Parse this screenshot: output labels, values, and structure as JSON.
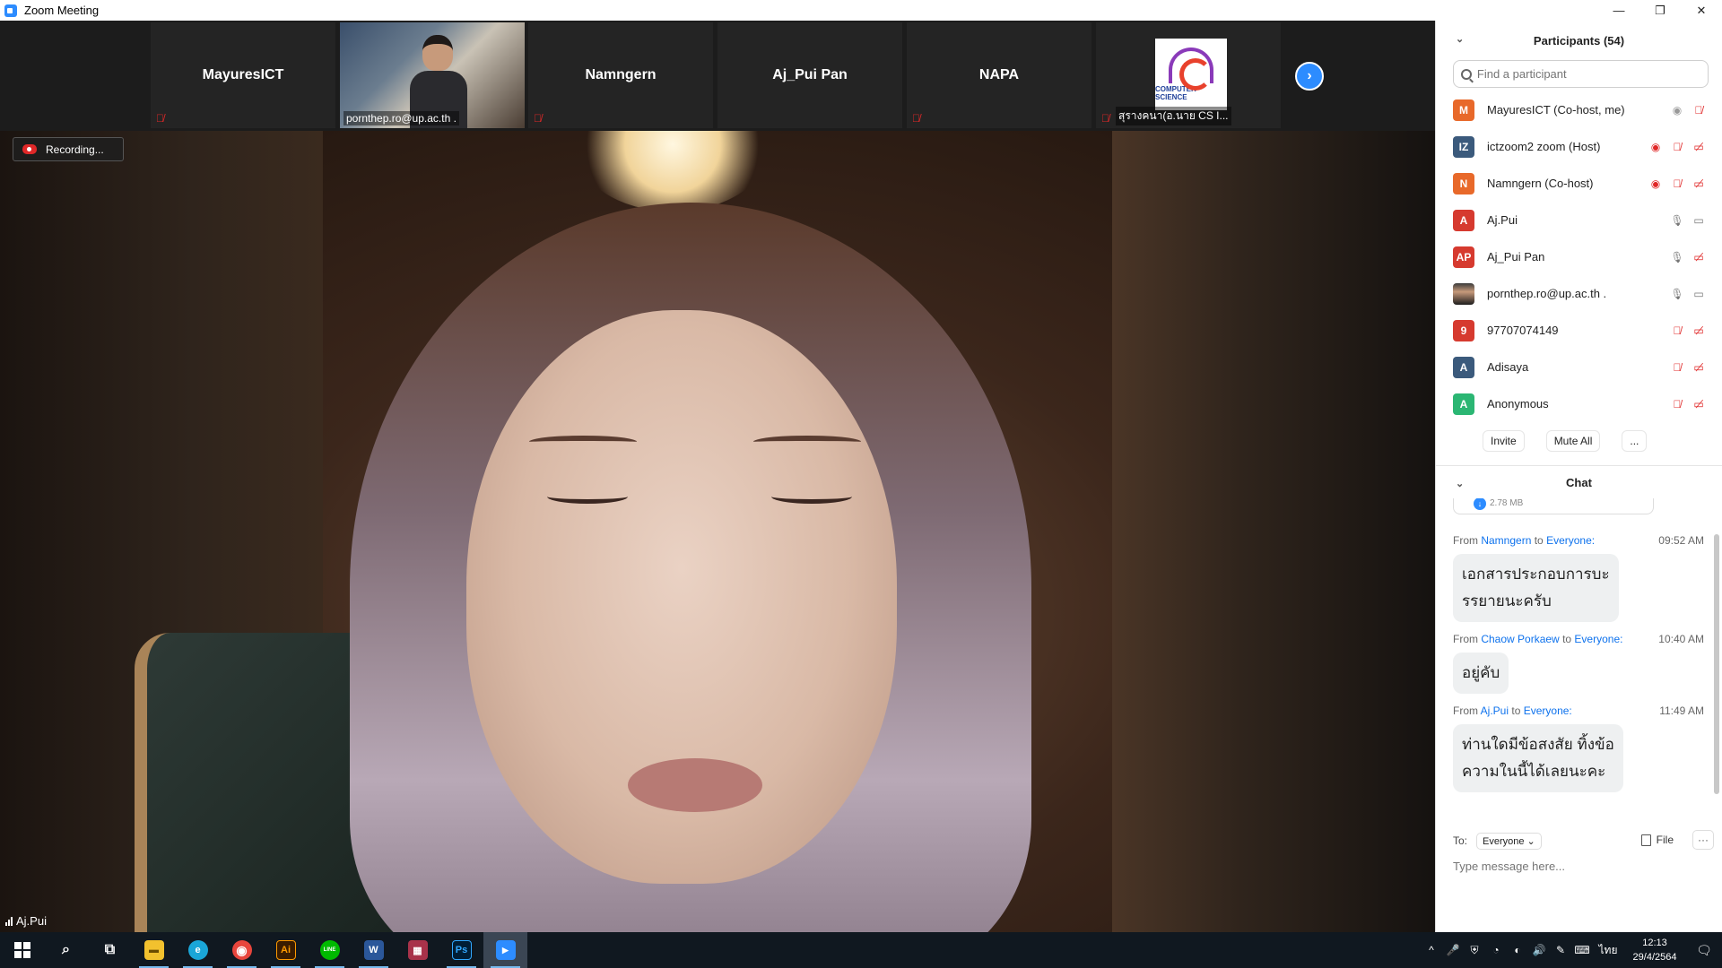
{
  "window": {
    "title": "Zoom Meeting",
    "controls": [
      "—",
      "❐",
      "✕"
    ]
  },
  "strip": {
    "tiles": [
      {
        "name": "MayuresICT",
        "type": "name",
        "mic_muted": true
      },
      {
        "name": "pornthep.ro@up.ac.th .",
        "type": "video",
        "mic_muted": true
      },
      {
        "name": "Namngern",
        "type": "name",
        "mic_muted": false
      },
      {
        "name": "Aj_Pui Pan",
        "type": "name",
        "mic_muted": false
      },
      {
        "name": "NAPA",
        "type": "name",
        "mic_muted": true
      },
      {
        "name": "สุรางคนา(อ.นาย CS I...",
        "type": "logo",
        "logo_text": "COMPUTER SCIENCE",
        "mic_muted": true
      }
    ],
    "next_icon": "chevron-right-icon"
  },
  "recording": {
    "label": "Recording..."
  },
  "active_speaker": {
    "name": "Aj.Pui"
  },
  "participants": {
    "title": "Participants (54)",
    "search_placeholder": "Find a participant",
    "list": [
      {
        "initials": "M",
        "color": "#e8692a",
        "name": "MayuresICT (Co-host, me)",
        "icons": [
          "rec-grey",
          "mic-off"
        ]
      },
      {
        "initials": "IZ",
        "color": "#3b5a7c",
        "name": "ictzoom2 zoom (Host)",
        "icons": [
          "rec",
          "mic-off",
          "cam-off"
        ]
      },
      {
        "initials": "N",
        "color": "#e8692a",
        "name": "Namngern (Co-host)",
        "icons": [
          "rec",
          "mic-off",
          "cam-off"
        ]
      },
      {
        "initials": "A",
        "color": "#d63a2f",
        "name": "Aj.Pui",
        "icons": [
          "mic-on",
          "cam-on"
        ]
      },
      {
        "initials": "AP",
        "color": "#d63a2f",
        "name": "Aj_Pui Pan",
        "icons": [
          "mic-on",
          "cam-off"
        ]
      },
      {
        "initials": "",
        "color": "photo",
        "name": "pornthep.ro@up.ac.th .",
        "icons": [
          "mic-on",
          "cam-on"
        ]
      },
      {
        "initials": "9",
        "color": "#d63a2f",
        "name": "97707074149",
        "icons": [
          "mic-off",
          "cam-off"
        ]
      },
      {
        "initials": "A",
        "color": "#3b5a7c",
        "name": "Adisaya",
        "icons": [
          "mic-off",
          "cam-off"
        ]
      },
      {
        "initials": "A",
        "color": "#2bb673",
        "name": "Anonymous",
        "icons": [
          "mic-off",
          "cam-off"
        ]
      }
    ],
    "actions": {
      "invite": "Invite",
      "mute_all": "Mute All",
      "more": "..."
    }
  },
  "chat": {
    "title": "Chat",
    "file_size": "2.78 MB",
    "messages": [
      {
        "from": "Namngern",
        "to": "Everyone:",
        "time": "09:52 AM",
        "text_lines": [
          "เอกสารประกอบการบะ",
          "รรยายนะครับ"
        ]
      },
      {
        "from": "Chaow Porkaew",
        "to": "Everyone:",
        "time": "10:40 AM",
        "text_lines": [
          "อยู่คับ"
        ]
      },
      {
        "from": "Aj.Pui",
        "to": "Everyone:",
        "time": "11:49 AM",
        "text_lines": [
          "ท่านใดมีข้อสงสัย ทิ้งข้อ",
          "ความในนี้ได้เลยนะคะ"
        ]
      }
    ],
    "from_word": "From",
    "to_word": "to",
    "footer": {
      "to_label": "To:",
      "to_value": "Everyone ⌄",
      "file_label": "File",
      "more": "···",
      "input_placeholder": "Type message here..."
    }
  },
  "taskbar": {
    "items": [
      {
        "name": "start",
        "label": ""
      },
      {
        "name": "search",
        "label": "⌕"
      },
      {
        "name": "task-view",
        "label": "⧉"
      },
      {
        "name": "file-explorer",
        "label": "▬",
        "color": "#f2c12e"
      },
      {
        "name": "edge",
        "label": "e",
        "color": "#1aa6d8"
      },
      {
        "name": "chrome",
        "label": "◉",
        "color": "#e8453c"
      },
      {
        "name": "illustrator",
        "label": "Ai",
        "color": "#3a1c00"
      },
      {
        "name": "line",
        "label": "LINE",
        "color": "#00b900"
      },
      {
        "name": "word",
        "label": "W",
        "color": "#2b579a"
      },
      {
        "name": "app-flag",
        "label": "▦",
        "color": "#a8324a"
      },
      {
        "name": "photoshop",
        "label": "Ps",
        "color": "#001e36"
      },
      {
        "name": "zoom",
        "label": "▶",
        "color": "#2d8cff"
      }
    ],
    "tray": {
      "icons": [
        "^",
        "🎤",
        "⛨",
        "◔",
        "◐",
        "🔊",
        "✎",
        "⌨",
        "ไทย"
      ],
      "time": "12:13",
      "date": "29/4/2564"
    }
  }
}
